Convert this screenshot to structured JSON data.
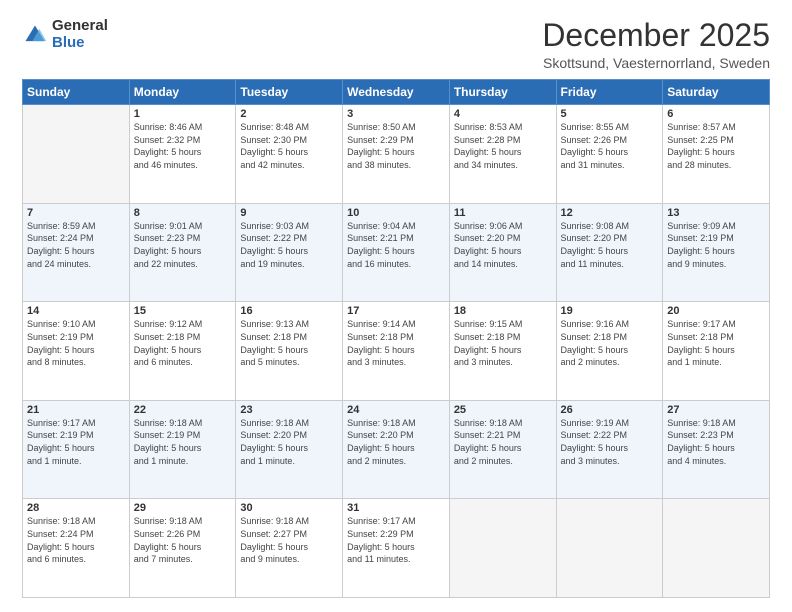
{
  "logo": {
    "general": "General",
    "blue": "Blue"
  },
  "header": {
    "title": "December 2025",
    "subtitle": "Skottsund, Vaesternorrland, Sweden"
  },
  "weekdays": [
    "Sunday",
    "Monday",
    "Tuesday",
    "Wednesday",
    "Thursday",
    "Friday",
    "Saturday"
  ],
  "weeks": [
    [
      {
        "day": "",
        "info": ""
      },
      {
        "day": "1",
        "info": "Sunrise: 8:46 AM\nSunset: 2:32 PM\nDaylight: 5 hours\nand 46 minutes."
      },
      {
        "day": "2",
        "info": "Sunrise: 8:48 AM\nSunset: 2:30 PM\nDaylight: 5 hours\nand 42 minutes."
      },
      {
        "day": "3",
        "info": "Sunrise: 8:50 AM\nSunset: 2:29 PM\nDaylight: 5 hours\nand 38 minutes."
      },
      {
        "day": "4",
        "info": "Sunrise: 8:53 AM\nSunset: 2:28 PM\nDaylight: 5 hours\nand 34 minutes."
      },
      {
        "day": "5",
        "info": "Sunrise: 8:55 AM\nSunset: 2:26 PM\nDaylight: 5 hours\nand 31 minutes."
      },
      {
        "day": "6",
        "info": "Sunrise: 8:57 AM\nSunset: 2:25 PM\nDaylight: 5 hours\nand 28 minutes."
      }
    ],
    [
      {
        "day": "7",
        "info": "Sunrise: 8:59 AM\nSunset: 2:24 PM\nDaylight: 5 hours\nand 24 minutes."
      },
      {
        "day": "8",
        "info": "Sunrise: 9:01 AM\nSunset: 2:23 PM\nDaylight: 5 hours\nand 22 minutes."
      },
      {
        "day": "9",
        "info": "Sunrise: 9:03 AM\nSunset: 2:22 PM\nDaylight: 5 hours\nand 19 minutes."
      },
      {
        "day": "10",
        "info": "Sunrise: 9:04 AM\nSunset: 2:21 PM\nDaylight: 5 hours\nand 16 minutes."
      },
      {
        "day": "11",
        "info": "Sunrise: 9:06 AM\nSunset: 2:20 PM\nDaylight: 5 hours\nand 14 minutes."
      },
      {
        "day": "12",
        "info": "Sunrise: 9:08 AM\nSunset: 2:20 PM\nDaylight: 5 hours\nand 11 minutes."
      },
      {
        "day": "13",
        "info": "Sunrise: 9:09 AM\nSunset: 2:19 PM\nDaylight: 5 hours\nand 9 minutes."
      }
    ],
    [
      {
        "day": "14",
        "info": "Sunrise: 9:10 AM\nSunset: 2:19 PM\nDaylight: 5 hours\nand 8 minutes."
      },
      {
        "day": "15",
        "info": "Sunrise: 9:12 AM\nSunset: 2:18 PM\nDaylight: 5 hours\nand 6 minutes."
      },
      {
        "day": "16",
        "info": "Sunrise: 9:13 AM\nSunset: 2:18 PM\nDaylight: 5 hours\nand 5 minutes."
      },
      {
        "day": "17",
        "info": "Sunrise: 9:14 AM\nSunset: 2:18 PM\nDaylight: 5 hours\nand 3 minutes."
      },
      {
        "day": "18",
        "info": "Sunrise: 9:15 AM\nSunset: 2:18 PM\nDaylight: 5 hours\nand 3 minutes."
      },
      {
        "day": "19",
        "info": "Sunrise: 9:16 AM\nSunset: 2:18 PM\nDaylight: 5 hours\nand 2 minutes."
      },
      {
        "day": "20",
        "info": "Sunrise: 9:17 AM\nSunset: 2:18 PM\nDaylight: 5 hours\nand 1 minute."
      }
    ],
    [
      {
        "day": "21",
        "info": "Sunrise: 9:17 AM\nSunset: 2:19 PM\nDaylight: 5 hours\nand 1 minute."
      },
      {
        "day": "22",
        "info": "Sunrise: 9:18 AM\nSunset: 2:19 PM\nDaylight: 5 hours\nand 1 minute."
      },
      {
        "day": "23",
        "info": "Sunrise: 9:18 AM\nSunset: 2:20 PM\nDaylight: 5 hours\nand 1 minute."
      },
      {
        "day": "24",
        "info": "Sunrise: 9:18 AM\nSunset: 2:20 PM\nDaylight: 5 hours\nand 2 minutes."
      },
      {
        "day": "25",
        "info": "Sunrise: 9:18 AM\nSunset: 2:21 PM\nDaylight: 5 hours\nand 2 minutes."
      },
      {
        "day": "26",
        "info": "Sunrise: 9:19 AM\nSunset: 2:22 PM\nDaylight: 5 hours\nand 3 minutes."
      },
      {
        "day": "27",
        "info": "Sunrise: 9:18 AM\nSunset: 2:23 PM\nDaylight: 5 hours\nand 4 minutes."
      }
    ],
    [
      {
        "day": "28",
        "info": "Sunrise: 9:18 AM\nSunset: 2:24 PM\nDaylight: 5 hours\nand 6 minutes."
      },
      {
        "day": "29",
        "info": "Sunrise: 9:18 AM\nSunset: 2:26 PM\nDaylight: 5 hours\nand 7 minutes."
      },
      {
        "day": "30",
        "info": "Sunrise: 9:18 AM\nSunset: 2:27 PM\nDaylight: 5 hours\nand 9 minutes."
      },
      {
        "day": "31",
        "info": "Sunrise: 9:17 AM\nSunset: 2:29 PM\nDaylight: 5 hours\nand 11 minutes."
      },
      {
        "day": "",
        "info": ""
      },
      {
        "day": "",
        "info": ""
      },
      {
        "day": "",
        "info": ""
      }
    ]
  ]
}
